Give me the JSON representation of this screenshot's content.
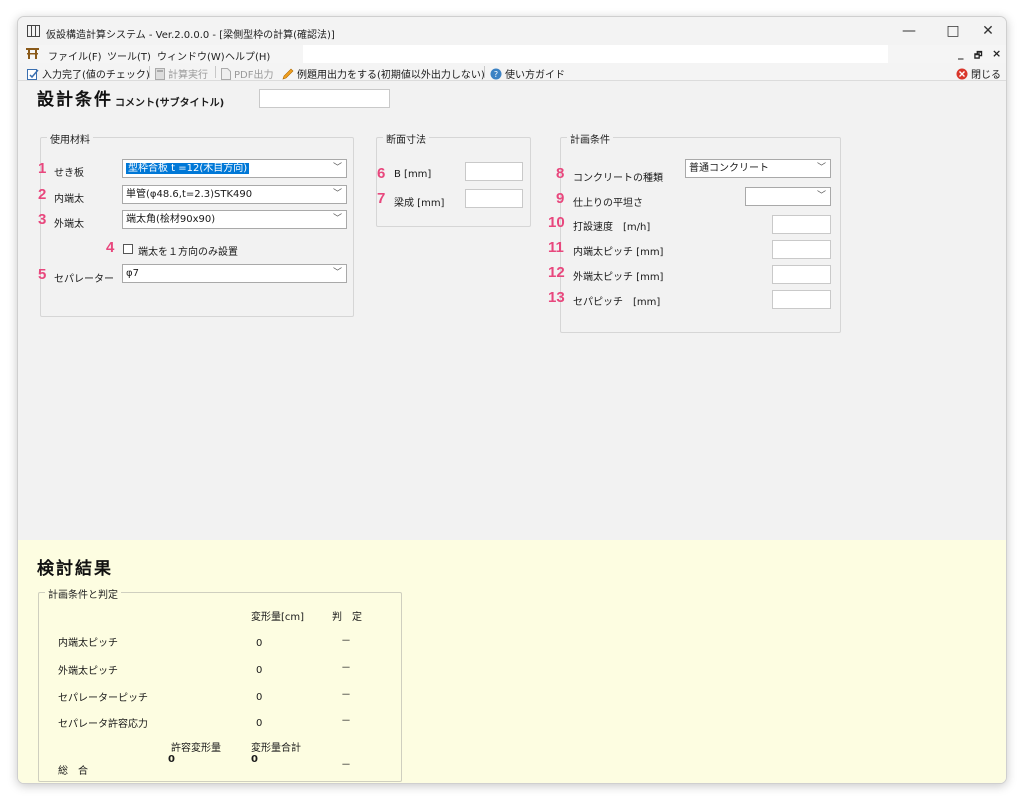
{
  "window": {
    "title": "仮設構造計算システム - Ver.2.0.0.0 - [梁側型枠の計算(確認法)]",
    "minimize": "—",
    "maximize": "□",
    "close": "✕"
  },
  "menu": {
    "file": "ファイル(F)",
    "tools": "ツール(T)",
    "window": "ウィンドウ(W)",
    "help": "ヘルプ(H)",
    "mdi_min": "_",
    "mdi_restore": "🗗",
    "mdi_close": "×"
  },
  "toolbar": {
    "input_done": "入力完了(値のチェック)",
    "calc": "計算実行",
    "pdf": "PDF出力",
    "example_output": "例題用出力をする(初期値以外出力しない)",
    "guide": "使い方ガイド",
    "close": "閉じる"
  },
  "design": {
    "title": "設計条件",
    "comment_label": "コメント(サブタイトル)",
    "materials": {
      "group": "使用材料",
      "sekiita_label": "せき板",
      "sekiita_value": "型枠合板 t =12(木目方向)",
      "uchibata_label": "内端太",
      "uchibata_value": "単管(φ48.6,t=2.3)STK490",
      "sotobata_label": "外端太",
      "sotobata_value": "端太角(桧材90x90)",
      "one_direction_label": "端太を１方向のみ設置",
      "separator_label": "セパレーター",
      "separator_value": "φ7"
    },
    "section": {
      "group": "断面寸法",
      "b_label": "B [mm]",
      "h_label": "梁成 [mm]"
    },
    "plan": {
      "group": "計画条件",
      "concrete_label": "コンクリートの種類",
      "concrete_value": "普通コンクリート",
      "flatness_label": "仕上りの平坦さ",
      "speed_label": "打設速度　[m/h]",
      "inner_pitch_label": "内端太ピッチ [mm]",
      "outer_pitch_label": "外端太ピッチ [mm]",
      "sep_pitch_label": "セパピッチ　[mm]"
    },
    "numbers": [
      "1",
      "2",
      "3",
      "4",
      "5",
      "6",
      "7",
      "8",
      "9",
      "10",
      "11",
      "12",
      "13"
    ]
  },
  "results": {
    "title": "検討結果",
    "group": "計画条件と判定",
    "col_deform": "変形量[cm]",
    "col_judge": "判　定",
    "rows": [
      {
        "label": "内端太ピッチ",
        "value": "0",
        "judge": "－"
      },
      {
        "label": "外端太ピッチ",
        "value": "0",
        "judge": "－"
      },
      {
        "label": "セパレーターピッチ",
        "value": "0",
        "judge": "－"
      },
      {
        "label": "セパレータ許容応力",
        "value": "0",
        "judge": "－"
      }
    ],
    "allow_label": "許容変形量",
    "sum_label": "変形量合計",
    "total_label": "総　合",
    "allow_value": "0",
    "sum_value": "0",
    "total_judge": "－"
  },
  "colors": {
    "number_badge": "#e8477d",
    "selection": "#0078d7",
    "results_bg": "#fdfde1"
  }
}
